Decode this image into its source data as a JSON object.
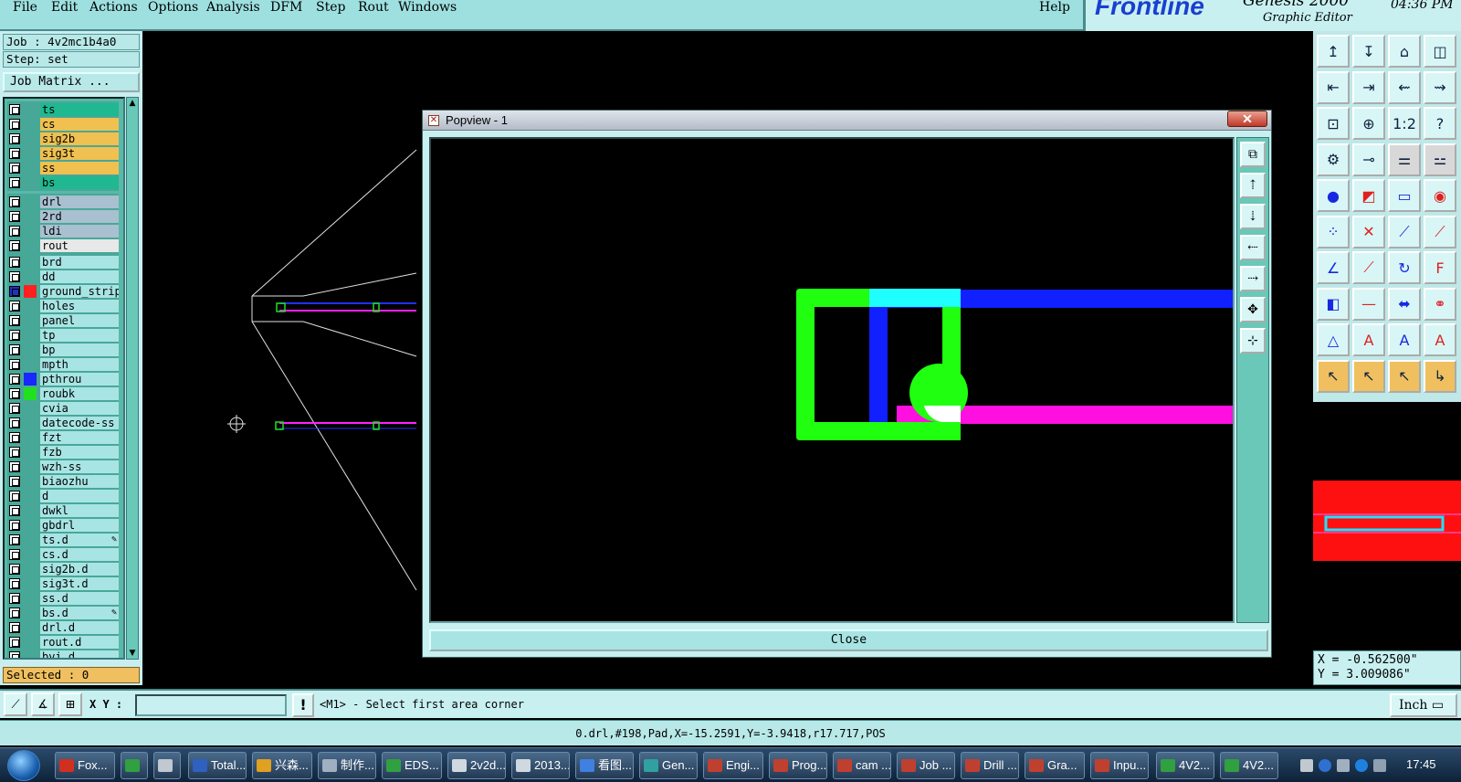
{
  "menubar": {
    "items": [
      "File",
      "Edit",
      "Actions",
      "Options",
      "Analysis",
      "DFM",
      "Step",
      "Rout",
      "Windows"
    ],
    "help": "Help"
  },
  "branding": {
    "logo": "Frontline",
    "product": "Genesis 2000",
    "subtitle": "Graphic Editor",
    "clock": "04:36 PM"
  },
  "left_panel": {
    "job": "Job : 4v2mc1b4a0",
    "step": "Step: set",
    "job_matrix_label": "Job Matrix ...",
    "selected": "Selected : 0",
    "layer_groups": [
      {
        "bg": "#48a898",
        "layers": [
          {
            "name": "ts",
            "color": "#20b890"
          },
          {
            "name": "cs",
            "color": "#f0c050"
          },
          {
            "name": "sig2b",
            "color": "#f0c050"
          },
          {
            "name": "sig3t",
            "color": "#f0c050"
          },
          {
            "name": "ss",
            "color": "#f0c050"
          },
          {
            "name": "bs",
            "color": "#20b890"
          }
        ]
      },
      {
        "bg": "#48a898",
        "layers": [
          {
            "name": "drl",
            "color": "#a8c0d0"
          },
          {
            "name": "2rd",
            "color": "#a8c0d0"
          },
          {
            "name": "ldi",
            "color": "#a8c0d0"
          },
          {
            "name": "rout",
            "color": "#e8e8e8"
          }
        ]
      },
      {
        "bg": "#48a898",
        "layers": [
          {
            "name": "brd",
            "color": "#a8e4e4"
          },
          {
            "name": "dd",
            "color": "#a8e4e4"
          },
          {
            "name": "ground_strip",
            "color": "#a8e4e4",
            "indicator": "#ff2020",
            "box": "#2030c0"
          },
          {
            "name": "holes",
            "color": "#a8e4e4"
          },
          {
            "name": "panel",
            "color": "#a8e4e4"
          },
          {
            "name": "tp",
            "color": "#a8e4e4"
          },
          {
            "name": "bp",
            "color": "#a8e4e4"
          },
          {
            "name": "mpth",
            "color": "#a8e4e4"
          },
          {
            "name": "pthrou",
            "color": "#a8e4e4",
            "indicator": "#1828ff"
          },
          {
            "name": "roubk",
            "color": "#a8e4e4",
            "indicator": "#20e020"
          },
          {
            "name": "cvia",
            "color": "#a8e4e4"
          },
          {
            "name": "datecode-ss",
            "color": "#a8e4e4"
          },
          {
            "name": "fzt",
            "color": "#a8e4e4"
          },
          {
            "name": "fzb",
            "color": "#a8e4e4"
          },
          {
            "name": "wzh-ss",
            "color": "#a8e4e4"
          },
          {
            "name": "biaozhu",
            "color": "#a8e4e4"
          },
          {
            "name": "d",
            "color": "#a8e4e4"
          },
          {
            "name": "dwkl",
            "color": "#a8e4e4"
          },
          {
            "name": "gbdrl",
            "color": "#a8e4e4"
          },
          {
            "name": "ts.d",
            "color": "#a8e4e4",
            "mark": "✎"
          },
          {
            "name": "cs.d",
            "color": "#a8e4e4"
          },
          {
            "name": "sig2b.d",
            "color": "#a8e4e4"
          },
          {
            "name": "sig3t.d",
            "color": "#a8e4e4"
          },
          {
            "name": "ss.d",
            "color": "#a8e4e4"
          },
          {
            "name": "bs.d",
            "color": "#a8e4e4",
            "mark": "✎"
          },
          {
            "name": "drl.d",
            "color": "#a8e4e4"
          },
          {
            "name": "rout.d",
            "color": "#a8e4e4"
          },
          {
            "name": "bvi.d",
            "color": "#a8e4e4"
          }
        ]
      }
    ]
  },
  "popview": {
    "title": "Popview - 1",
    "close_x": "✕",
    "close_button": "Close",
    "tool_icons": [
      "zoom-window-icon",
      "zoom-home-icon",
      "zoom-in-icon",
      "zoom-out-icon",
      "pan-left-icon",
      "pan-right-icon",
      "fit-icon",
      "center-icon"
    ]
  },
  "toolbox": {
    "rows": [
      [
        "↥",
        "↧",
        "⌂",
        "◫"
      ],
      [
        "⇤",
        "⇥",
        "⇜",
        "⇝"
      ],
      [
        "⊡",
        "⊕",
        "1:2",
        "?"
      ],
      [
        "⚙",
        "⊸",
        "⚌",
        "⚍"
      ],
      [
        "●",
        "◩",
        "▭",
        "◉"
      ],
      [
        "⁘",
        "✕",
        "⟋",
        "⟋"
      ],
      [
        "∠",
        "⟋",
        "↻",
        "F"
      ],
      [
        "◧",
        "—",
        "⬌",
        "⚭"
      ],
      [
        "△",
        "A",
        "A",
        "A"
      ],
      [
        "↖",
        "↖",
        "↖",
        "↳"
      ]
    ]
  },
  "coords": {
    "x": "X = -0.562500\"",
    "y": "Y = 3.009086\""
  },
  "command": {
    "xy_label": "X Y :",
    "xy_value": "",
    "prompt_icon": "!",
    "prompt": "<M1> - Select first area corner",
    "units": "Inch ▭"
  },
  "status": {
    "text": "0.drl,#198,Pad,X=-15.2591,Y=-3.9418,r17.717,POS"
  },
  "taskbar": {
    "tasks": [
      {
        "label": "Fox...",
        "icon": "#d03020"
      },
      {
        "label": "",
        "icon": "#30a040"
      },
      {
        "label": "",
        "icon": "#c0c8d0"
      },
      {
        "label": "Total...",
        "icon": "#3060c0"
      },
      {
        "label": "兴森...",
        "icon": "#e0a020"
      },
      {
        "label": "制作...",
        "icon": "#a0b0c0"
      },
      {
        "label": "EDS...",
        "icon": "#30a040"
      },
      {
        "label": "2v2d...",
        "icon": "#d0d8e0"
      },
      {
        "label": "2013...",
        "icon": "#d0d8e0"
      },
      {
        "label": "看图...",
        "icon": "#4080e0"
      },
      {
        "label": "Gen...",
        "icon": "#30a0a0"
      },
      {
        "label": "Engi...",
        "icon": "#c04030"
      },
      {
        "label": "Prog...",
        "icon": "#c04030"
      },
      {
        "label": "cam ...",
        "icon": "#c04030"
      },
      {
        "label": "Job ...",
        "icon": "#c04030"
      },
      {
        "label": "Drill ...",
        "icon": "#c04030"
      },
      {
        "label": "Gra...",
        "icon": "#c04030"
      },
      {
        "label": "Inpu...",
        "icon": "#c04030"
      },
      {
        "label": "4V2...",
        "icon": "#30a040"
      },
      {
        "label": "4V2...",
        "icon": "#30a040"
      }
    ],
    "clock": "17:45"
  }
}
